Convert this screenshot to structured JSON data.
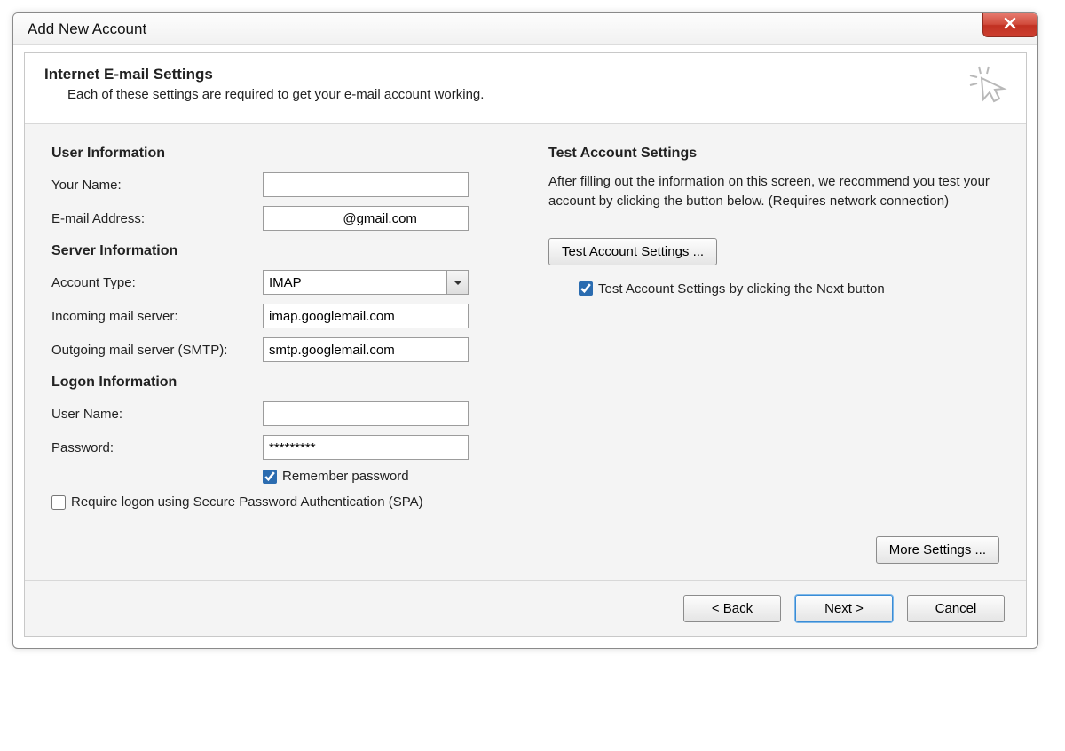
{
  "titlebar": {
    "title": "Add New Account"
  },
  "header": {
    "title": "Internet E-mail Settings",
    "subtitle": "Each of these settings are required to get your e-mail account working."
  },
  "sections": {
    "user": "User Information",
    "server": "Server Information",
    "logon": "Logon Information"
  },
  "labels": {
    "your_name": "Your Name:",
    "email": "E-mail Address:",
    "account_type": "Account Type:",
    "incoming": "Incoming mail server:",
    "outgoing": "Outgoing mail server (SMTP):",
    "username": "User Name:",
    "password": "Password:"
  },
  "values": {
    "your_name": "      ",
    "email": "                    @gmail.com",
    "account_type": "IMAP",
    "incoming": "imap.googlemail.com",
    "outgoing": "smtp.googlemail.com",
    "username": "              ",
    "password": "*********"
  },
  "checkboxes": {
    "remember": "Remember password",
    "remember_checked": true,
    "spa": "Require logon using Secure Password Authentication (SPA)",
    "spa_checked": false
  },
  "right": {
    "heading": "Test Account Settings",
    "body": "After filling out the information on this screen, we recommend you test your account by clicking the button below. (Requires network connection)",
    "test_button": "Test Account Settings ...",
    "test_checkbox": "Test Account Settings by clicking the Next button",
    "test_checked": true
  },
  "buttons": {
    "more": "More Settings ...",
    "back": "< Back",
    "next": "Next >",
    "cancel": "Cancel"
  }
}
